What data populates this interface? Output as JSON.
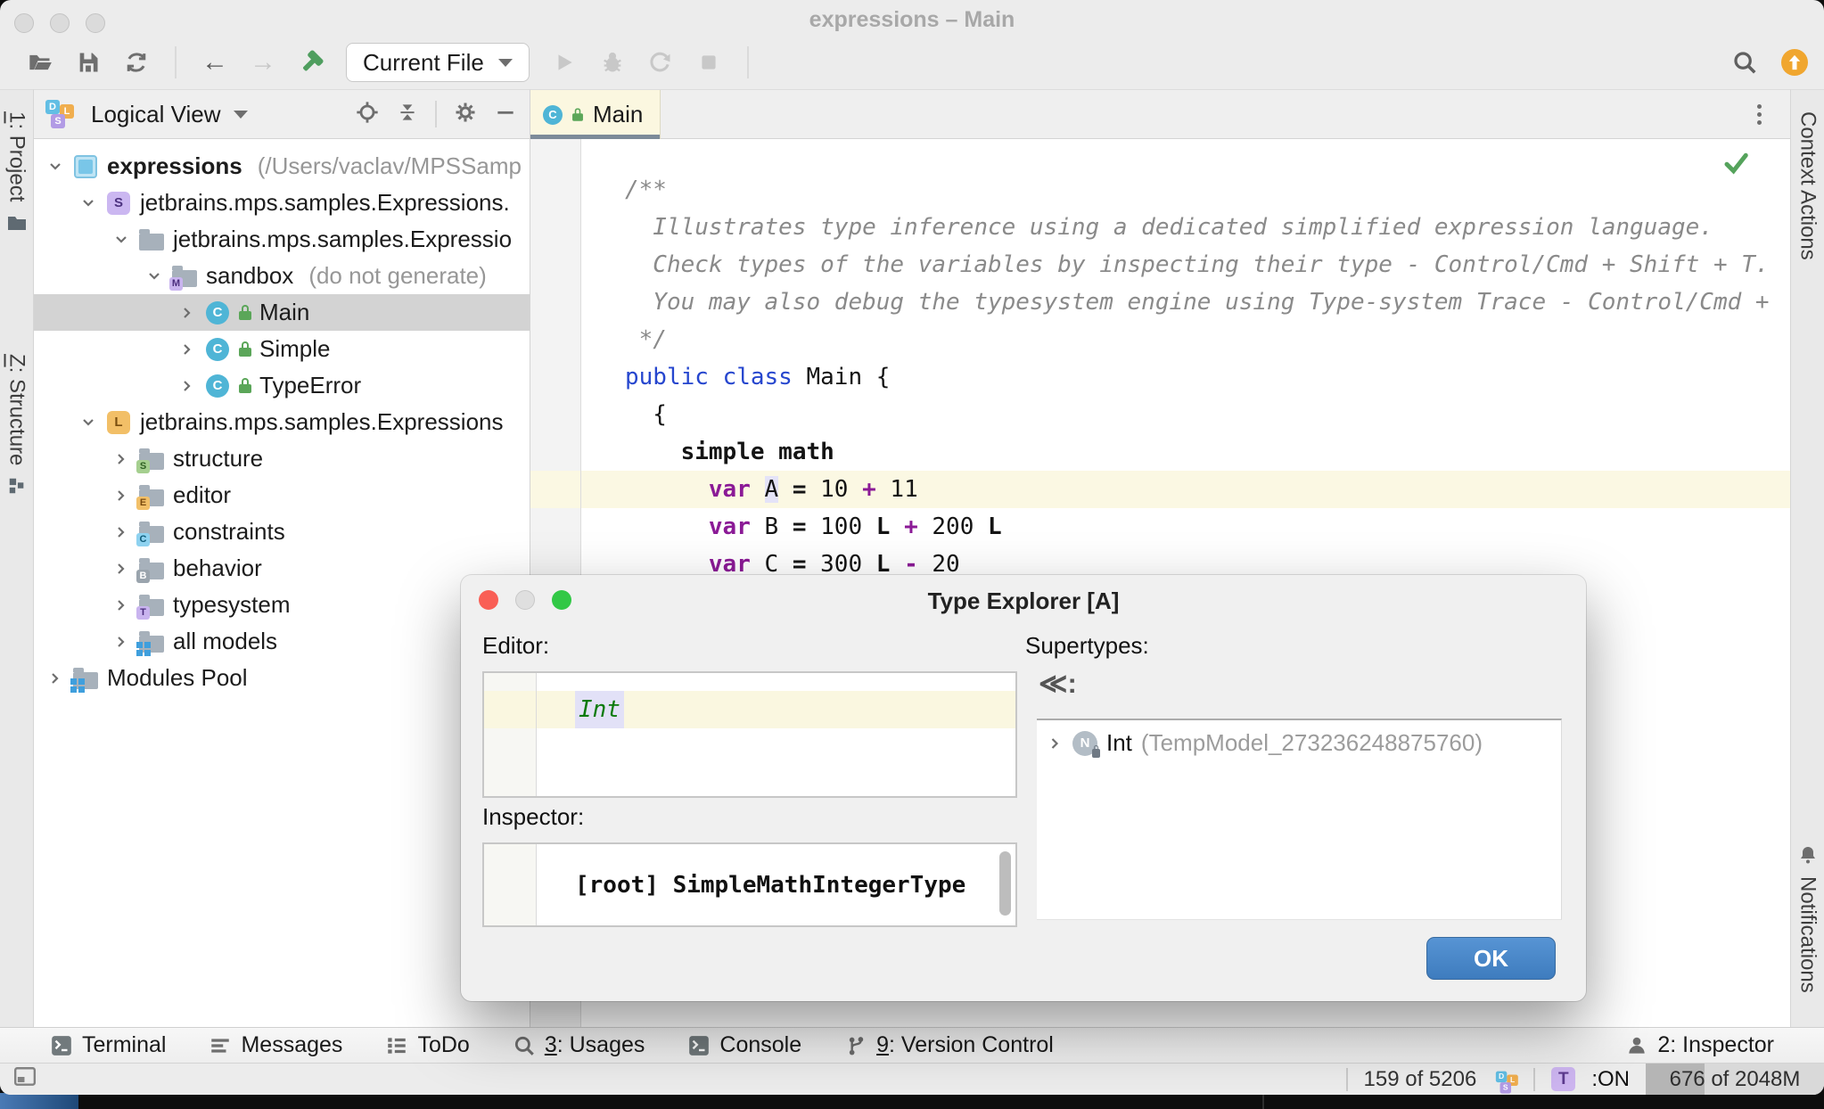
{
  "window": {
    "title": "expressions – Main"
  },
  "toolbar": {
    "run_config": "Current File"
  },
  "stripes": {
    "left_project": {
      "mnemonic": "1",
      "rest": ": Project"
    },
    "left_structure": {
      "mnemonic": "Z",
      "rest": ": Structure"
    },
    "right_top": "Context Actions",
    "right_bottom": "Notifications"
  },
  "project_panel": {
    "view": "Logical View",
    "tree": [
      {
        "indent": 0,
        "expanded": true,
        "icon": "project",
        "label": "expressions",
        "bold": true,
        "suffix": "(/Users/vaclav/MPSSamp"
      },
      {
        "indent": 1,
        "expanded": true,
        "icon": "solution",
        "label": "jetbrains.mps.samples.Expressions."
      },
      {
        "indent": 2,
        "expanded": true,
        "icon": "folder",
        "label": "jetbrains.mps.samples.Expressio"
      },
      {
        "indent": 3,
        "expanded": true,
        "icon": "model",
        "label": "sandbox",
        "suffix": "(do not generate)"
      },
      {
        "indent": 4,
        "expanded": false,
        "icon": "class",
        "label": "Main",
        "selected": true
      },
      {
        "indent": 4,
        "expanded": false,
        "icon": "class",
        "label": "Simple"
      },
      {
        "indent": 4,
        "expanded": false,
        "icon": "class",
        "label": "TypeError"
      },
      {
        "indent": 1,
        "expanded": true,
        "icon": "language",
        "label": "jetbrains.mps.samples.Expressions"
      },
      {
        "indent": 2,
        "expanded": false,
        "icon": "folder-s",
        "label": "structure"
      },
      {
        "indent": 2,
        "expanded": false,
        "icon": "folder-e",
        "label": "editor"
      },
      {
        "indent": 2,
        "expanded": false,
        "icon": "folder-c",
        "label": "constraints"
      },
      {
        "indent": 2,
        "expanded": false,
        "icon": "folder-b",
        "label": "behavior"
      },
      {
        "indent": 2,
        "expanded": false,
        "icon": "folder-t",
        "label": "typesystem"
      },
      {
        "indent": 2,
        "expanded": false,
        "icon": "models",
        "label": "all models"
      },
      {
        "indent": 0,
        "expanded": false,
        "icon": "modules",
        "label": "Modules Pool"
      }
    ]
  },
  "editor": {
    "tab": "Main",
    "lines": [
      {
        "indent": 0,
        "hl": false,
        "seg": [
          {
            "t": "/**",
            "s": "c"
          }
        ]
      },
      {
        "indent": 2,
        "hl": false,
        "seg": [
          {
            "t": "Illustrates type inference using a dedicated simplified expression language.",
            "s": "c"
          }
        ]
      },
      {
        "indent": 2,
        "hl": false,
        "seg": [
          {
            "t": "Check types of the variables by inspecting their type - Control/Cmd + Shift + T.",
            "s": "c"
          }
        ]
      },
      {
        "indent": 2,
        "hl": false,
        "seg": [
          {
            "t": "You may also debug the typesystem engine using Type-system Trace - Control/Cmd +",
            "s": "c"
          }
        ]
      },
      {
        "indent": 1,
        "hl": false,
        "seg": [
          {
            "t": "*/",
            "s": "c"
          }
        ]
      },
      {
        "indent": 0,
        "hl": false,
        "seg": [
          {
            "t": "public class ",
            "s": "b"
          },
          {
            "t": "Main {",
            "s": ""
          }
        ]
      },
      {
        "indent": 2,
        "hl": false,
        "seg": [
          {
            "t": "{",
            "s": ""
          }
        ]
      },
      {
        "indent": 4,
        "hl": false,
        "seg": [
          {
            "t": "simple math",
            "s": "k"
          }
        ]
      },
      {
        "indent": 6,
        "hl": true,
        "seg": [
          {
            "t": "var",
            "s": "p"
          },
          {
            "t": " ",
            "s": ""
          },
          {
            "t": "A",
            "s": "",
            "sel": true
          },
          {
            "t": " ",
            "s": ""
          },
          {
            "t": "=",
            "s": "k"
          },
          {
            "t": " 10 ",
            "s": ""
          },
          {
            "t": "+",
            "s": "p"
          },
          {
            "t": " 11",
            "s": ""
          }
        ]
      },
      {
        "indent": 6,
        "hl": false,
        "seg": [
          {
            "t": "var",
            "s": "p"
          },
          {
            "t": " B ",
            "s": ""
          },
          {
            "t": "=",
            "s": "k"
          },
          {
            "t": " 100 ",
            "s": ""
          },
          {
            "t": "L",
            "s": "k"
          },
          {
            "t": " ",
            "s": ""
          },
          {
            "t": "+",
            "s": "p"
          },
          {
            "t": " 200 ",
            "s": ""
          },
          {
            "t": "L",
            "s": "k"
          }
        ]
      },
      {
        "indent": 6,
        "hl": false,
        "seg": [
          {
            "t": "var",
            "s": "p"
          },
          {
            "t": " C ",
            "s": ""
          },
          {
            "t": "=",
            "s": "k"
          },
          {
            "t": " 300 ",
            "s": ""
          },
          {
            "t": "L",
            "s": "k"
          },
          {
            "t": " ",
            "s": ""
          },
          {
            "t": "-",
            "s": "p"
          },
          {
            "t": " 20",
            "s": ""
          }
        ]
      }
    ]
  },
  "dialog": {
    "title": "Type Explorer [A]",
    "editor_label": "Editor:",
    "editor_value": "Int",
    "inspector_label": "Inspector:",
    "inspector_value": "[root] SimpleMathIntegerType",
    "supertypes_label": "Supertypes:",
    "collapse_glyph": "≪:",
    "supertype": {
      "name": "Int",
      "model": "(TempModel_273236248875760)"
    },
    "ok_label": "OK"
  },
  "toolwindow_bar": {
    "items": [
      {
        "key": "terminal",
        "mnemonic": "",
        "label": "Terminal"
      },
      {
        "key": "messages",
        "mnemonic": "",
        "label": "Messages"
      },
      {
        "key": "todo",
        "mnemonic": "",
        "label": "ToDo"
      },
      {
        "key": "usages",
        "mnemonic": "3",
        "label": ": Usages"
      },
      {
        "key": "console",
        "mnemonic": "",
        "label": "Console"
      },
      {
        "key": "vcs",
        "mnemonic": "9",
        "label": ": Version Control"
      }
    ],
    "inspector": {
      "mnemonic": "2",
      "rest": ": Inspector"
    }
  },
  "status_bar": {
    "position": "159 of 5206",
    "typesystem_chip": "T",
    "typesystem_state": ":ON",
    "memory": "676 of 2048M",
    "memory_fraction": 0.33
  },
  "colors": {
    "accent_blue": "#3e7cbe",
    "keyword_blue": "#2646ce",
    "keyword_purple": "#8b1a96",
    "comment_gray": "#8a8a8a",
    "type_green": "#0a7a0a",
    "hammer_green": "#4f9e5f",
    "update_orange": "#f0a62f",
    "tab_yellow": "#fbf7e0",
    "line_highlight": "#fbf8e3",
    "selection_lavender": "#e4e3f8"
  }
}
